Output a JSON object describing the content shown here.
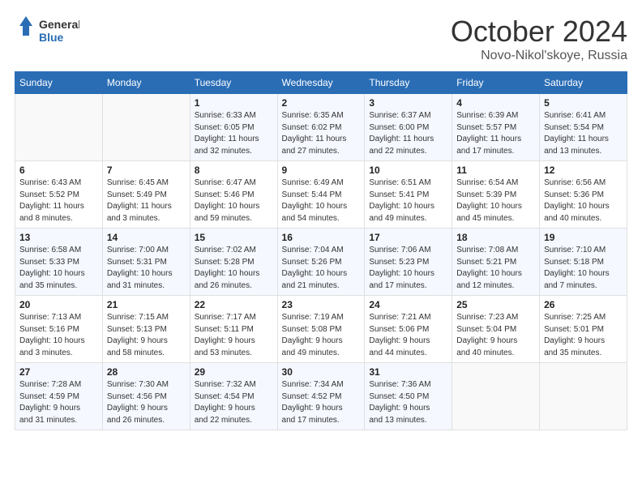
{
  "logo": {
    "line1": "General",
    "line2": "Blue"
  },
  "title": "October 2024",
  "location": "Novo-Nikol'skoye, Russia",
  "days_header": [
    "Sunday",
    "Monday",
    "Tuesday",
    "Wednesday",
    "Thursday",
    "Friday",
    "Saturday"
  ],
  "weeks": [
    [
      {
        "day": "",
        "info": ""
      },
      {
        "day": "",
        "info": ""
      },
      {
        "day": "1",
        "info": "Sunrise: 6:33 AM\nSunset: 6:05 PM\nDaylight: 11 hours\nand 32 minutes."
      },
      {
        "day": "2",
        "info": "Sunrise: 6:35 AM\nSunset: 6:02 PM\nDaylight: 11 hours\nand 27 minutes."
      },
      {
        "day": "3",
        "info": "Sunrise: 6:37 AM\nSunset: 6:00 PM\nDaylight: 11 hours\nand 22 minutes."
      },
      {
        "day": "4",
        "info": "Sunrise: 6:39 AM\nSunset: 5:57 PM\nDaylight: 11 hours\nand 17 minutes."
      },
      {
        "day": "5",
        "info": "Sunrise: 6:41 AM\nSunset: 5:54 PM\nDaylight: 11 hours\nand 13 minutes."
      }
    ],
    [
      {
        "day": "6",
        "info": "Sunrise: 6:43 AM\nSunset: 5:52 PM\nDaylight: 11 hours\nand 8 minutes."
      },
      {
        "day": "7",
        "info": "Sunrise: 6:45 AM\nSunset: 5:49 PM\nDaylight: 11 hours\nand 3 minutes."
      },
      {
        "day": "8",
        "info": "Sunrise: 6:47 AM\nSunset: 5:46 PM\nDaylight: 10 hours\nand 59 minutes."
      },
      {
        "day": "9",
        "info": "Sunrise: 6:49 AM\nSunset: 5:44 PM\nDaylight: 10 hours\nand 54 minutes."
      },
      {
        "day": "10",
        "info": "Sunrise: 6:51 AM\nSunset: 5:41 PM\nDaylight: 10 hours\nand 49 minutes."
      },
      {
        "day": "11",
        "info": "Sunrise: 6:54 AM\nSunset: 5:39 PM\nDaylight: 10 hours\nand 45 minutes."
      },
      {
        "day": "12",
        "info": "Sunrise: 6:56 AM\nSunset: 5:36 PM\nDaylight: 10 hours\nand 40 minutes."
      }
    ],
    [
      {
        "day": "13",
        "info": "Sunrise: 6:58 AM\nSunset: 5:33 PM\nDaylight: 10 hours\nand 35 minutes."
      },
      {
        "day": "14",
        "info": "Sunrise: 7:00 AM\nSunset: 5:31 PM\nDaylight: 10 hours\nand 31 minutes."
      },
      {
        "day": "15",
        "info": "Sunrise: 7:02 AM\nSunset: 5:28 PM\nDaylight: 10 hours\nand 26 minutes."
      },
      {
        "day": "16",
        "info": "Sunrise: 7:04 AM\nSunset: 5:26 PM\nDaylight: 10 hours\nand 21 minutes."
      },
      {
        "day": "17",
        "info": "Sunrise: 7:06 AM\nSunset: 5:23 PM\nDaylight: 10 hours\nand 17 minutes."
      },
      {
        "day": "18",
        "info": "Sunrise: 7:08 AM\nSunset: 5:21 PM\nDaylight: 10 hours\nand 12 minutes."
      },
      {
        "day": "19",
        "info": "Sunrise: 7:10 AM\nSunset: 5:18 PM\nDaylight: 10 hours\nand 7 minutes."
      }
    ],
    [
      {
        "day": "20",
        "info": "Sunrise: 7:13 AM\nSunset: 5:16 PM\nDaylight: 10 hours\nand 3 minutes."
      },
      {
        "day": "21",
        "info": "Sunrise: 7:15 AM\nSunset: 5:13 PM\nDaylight: 9 hours\nand 58 minutes."
      },
      {
        "day": "22",
        "info": "Sunrise: 7:17 AM\nSunset: 5:11 PM\nDaylight: 9 hours\nand 53 minutes."
      },
      {
        "day": "23",
        "info": "Sunrise: 7:19 AM\nSunset: 5:08 PM\nDaylight: 9 hours\nand 49 minutes."
      },
      {
        "day": "24",
        "info": "Sunrise: 7:21 AM\nSunset: 5:06 PM\nDaylight: 9 hours\nand 44 minutes."
      },
      {
        "day": "25",
        "info": "Sunrise: 7:23 AM\nSunset: 5:04 PM\nDaylight: 9 hours\nand 40 minutes."
      },
      {
        "day": "26",
        "info": "Sunrise: 7:25 AM\nSunset: 5:01 PM\nDaylight: 9 hours\nand 35 minutes."
      }
    ],
    [
      {
        "day": "27",
        "info": "Sunrise: 7:28 AM\nSunset: 4:59 PM\nDaylight: 9 hours\nand 31 minutes."
      },
      {
        "day": "28",
        "info": "Sunrise: 7:30 AM\nSunset: 4:56 PM\nDaylight: 9 hours\nand 26 minutes."
      },
      {
        "day": "29",
        "info": "Sunrise: 7:32 AM\nSunset: 4:54 PM\nDaylight: 9 hours\nand 22 minutes."
      },
      {
        "day": "30",
        "info": "Sunrise: 7:34 AM\nSunset: 4:52 PM\nDaylight: 9 hours\nand 17 minutes."
      },
      {
        "day": "31",
        "info": "Sunrise: 7:36 AM\nSunset: 4:50 PM\nDaylight: 9 hours\nand 13 minutes."
      },
      {
        "day": "",
        "info": ""
      },
      {
        "day": "",
        "info": ""
      }
    ]
  ]
}
